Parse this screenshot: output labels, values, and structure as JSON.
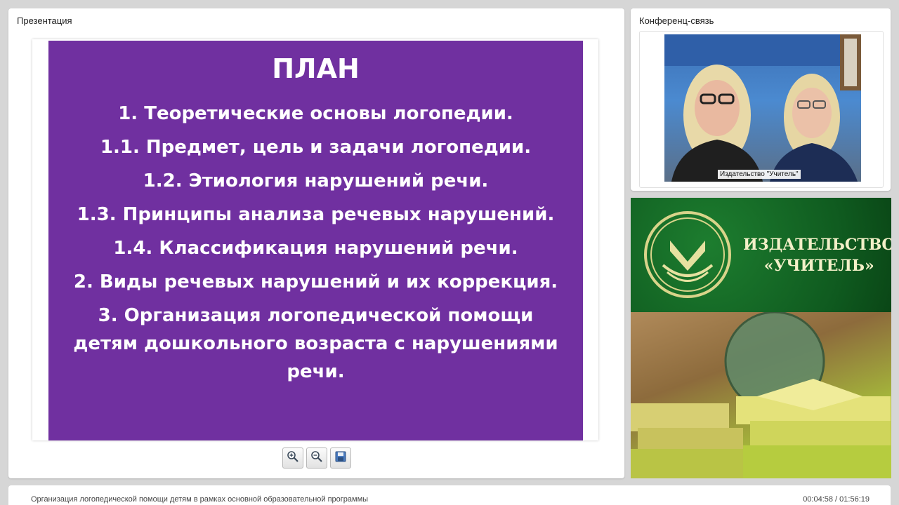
{
  "presentation": {
    "title": "Презентация",
    "slide": {
      "heading": "ПЛАН",
      "lines": [
        "1. Теоретические основы логопедии.",
        "1.1. Предмет, цель и задачи логопедии.",
        "1.2. Этиология нарушений речи.",
        "1.3. Принципы анализа речевых нарушений.",
        "1.4. Классификация нарушений речи.",
        "2. Виды речевых нарушений и их коррекция.",
        "3. Организация логопедической помощи детям дошкольного возраста с нарушениями речи."
      ]
    },
    "toolbar": {
      "zoom_in_icon": "zoom-in-icon",
      "zoom_out_icon": "zoom-out-icon",
      "save_icon": "save-icon"
    }
  },
  "conference": {
    "title": "Конференц-связь",
    "video_label": "Издательство \"Учитель\""
  },
  "banner": {
    "line1": "ИЗДАТЕЛЬСТВО",
    "line2": "«УЧИТЕЛЬ»"
  },
  "footer": {
    "title": "Организация логопедической помощи детям в рамках основной образовательной программы",
    "time": "00:04:58 / 01:56:19"
  },
  "colors": {
    "slide_background": "#7030a0",
    "banner_green": "#0f5a1f",
    "banner_text": "#f3f0c8"
  }
}
